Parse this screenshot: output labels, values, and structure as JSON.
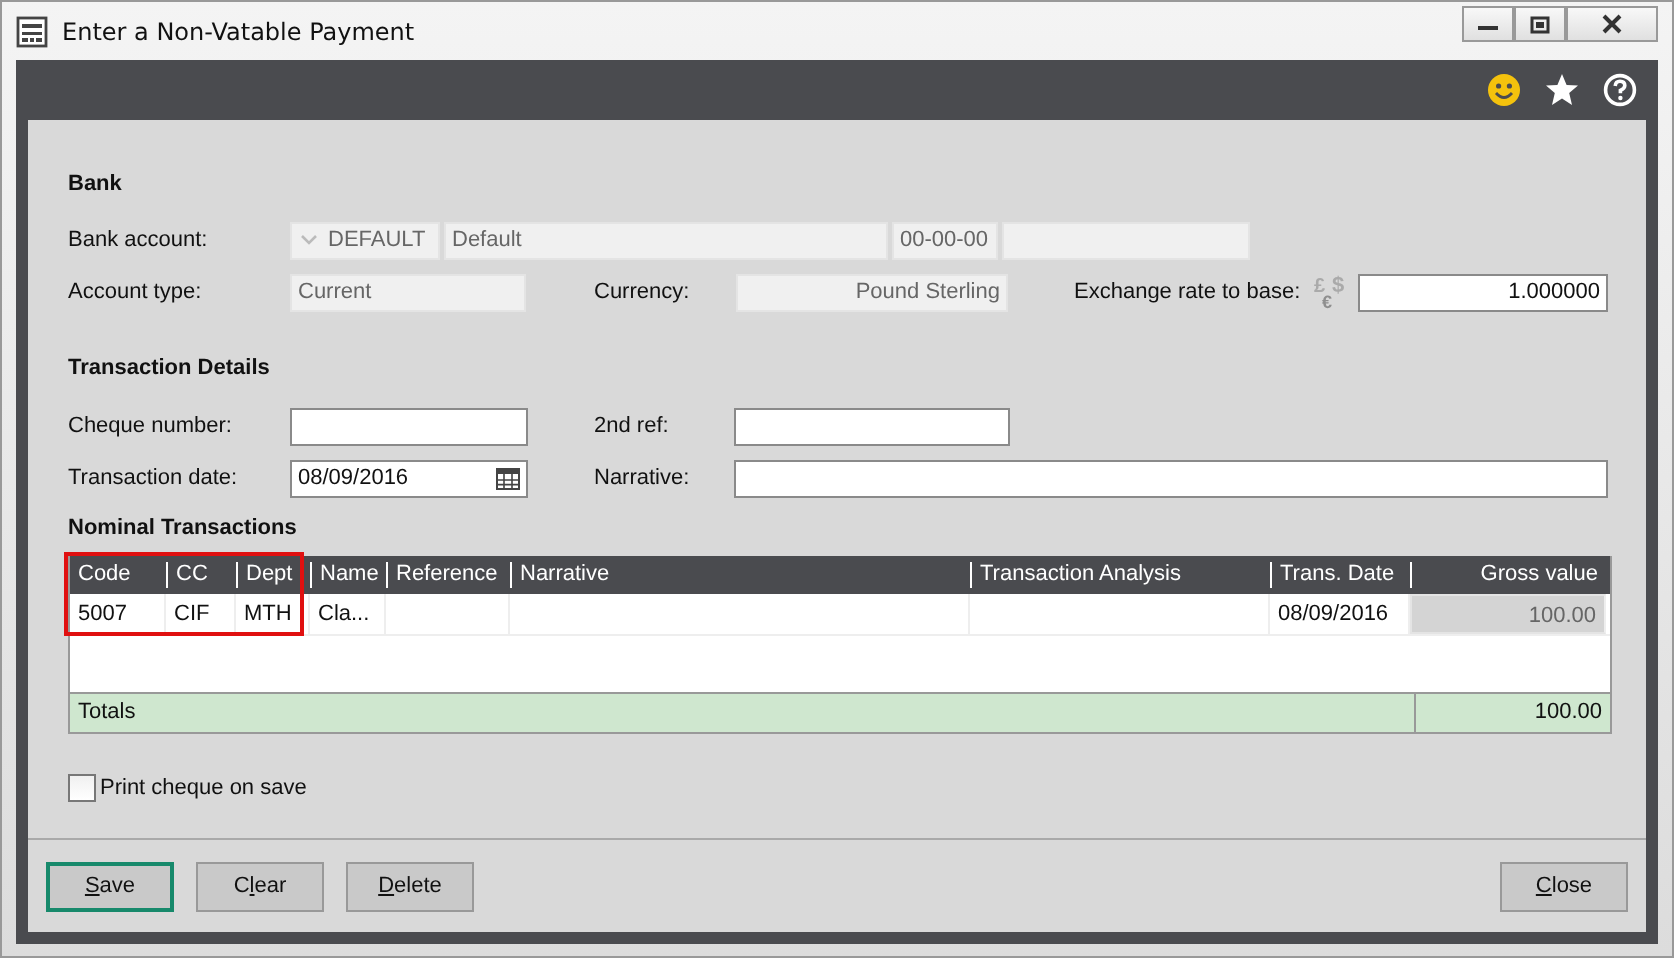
{
  "window": {
    "title": "Enter a Non-Vatable Payment"
  },
  "bank": {
    "heading": "Bank",
    "account_label": "Bank account:",
    "account_code": "DEFAULT",
    "account_name": "Default",
    "sort_code": "00-00-00",
    "account_type_label": "Account type:",
    "account_type": "Current",
    "currency_label": "Currency:",
    "currency": "Pound Sterling",
    "exchange_label": "Exchange rate to base:",
    "currency_symbols": [
      "£",
      "$",
      "€"
    ],
    "exchange_rate": "1.000000"
  },
  "transaction_details": {
    "heading": "Transaction Details",
    "cheque_label": "Cheque number:",
    "second_ref_label": "2nd ref:",
    "date_label": "Transaction date:",
    "date": "08/09/2016",
    "narrative_label": "Narrative:"
  },
  "nominal": {
    "heading": "Nominal Transactions",
    "columns": [
      {
        "label": "Code",
        "readonly": false
      },
      {
        "label": "CC",
        "readonly": false
      },
      {
        "label": "Dept",
        "readonly": false
      },
      {
        "label": "Name",
        "readonly": false
      },
      {
        "label": "Reference",
        "readonly": false
      },
      {
        "label": "Narrative",
        "readonly": false
      },
      {
        "label": "Transaction Analysis",
        "readonly": false
      },
      {
        "label": "Trans. Date",
        "readonly": false
      },
      {
        "label": "Gross value",
        "readonly": true
      }
    ],
    "rows": [
      {
        "cells": [
          "5007",
          "CIF",
          "MTH",
          "Cla..."
        ],
        "trans_date": "08/09/2016",
        "gross_value": "100.00"
      }
    ],
    "totals_label": "Totals",
    "totals_value": "100.00"
  },
  "print_cheque": {
    "label": "Print cheque on save",
    "checked": false
  },
  "buttons": [
    {
      "access_key": "S",
      "rest": "ave",
      "default": true
    },
    {
      "before": "C",
      "access_key": "l",
      "rest": "ear",
      "default": false
    },
    {
      "access_key": "D",
      "rest": "elete",
      "default": false
    }
  ],
  "close_button": {
    "access_key": "C",
    "rest": "lose",
    "default": false
  }
}
